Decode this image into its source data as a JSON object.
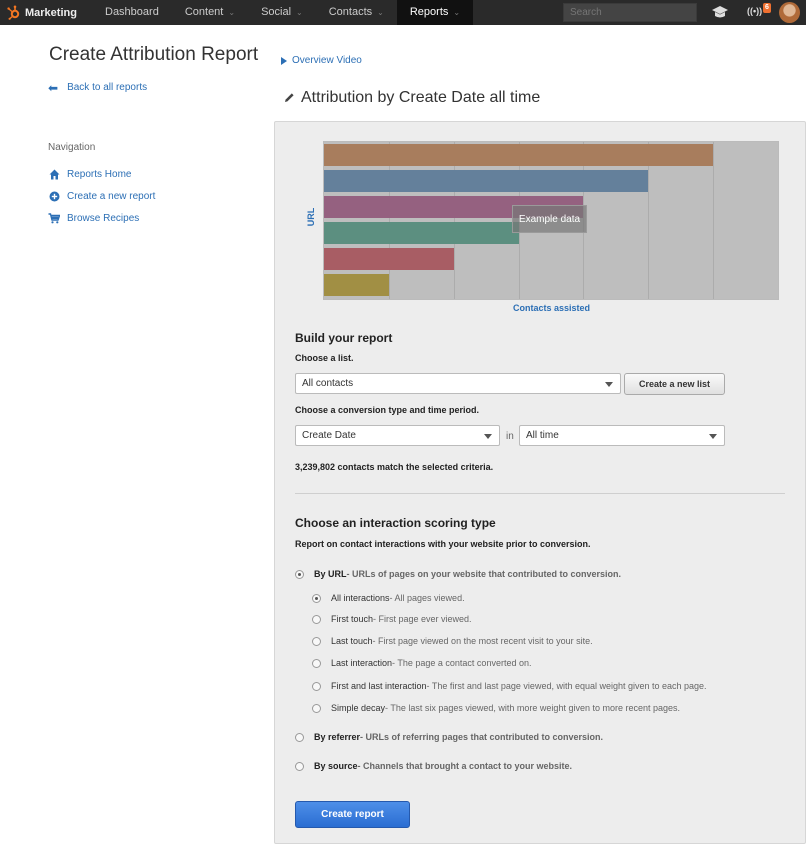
{
  "topnav": {
    "brand": "Marketing",
    "items": [
      {
        "label": "Dashboard",
        "caret": ""
      },
      {
        "label": "Content",
        "caret": "⌄"
      },
      {
        "label": "Social",
        "caret": "⌄"
      },
      {
        "label": "Contacts",
        "caret": "⌄"
      },
      {
        "label": "Reports",
        "caret": "⌄"
      }
    ],
    "active_item": "Reports",
    "search_placeholder": "Search",
    "notifications_icon": "((•))",
    "notification_count": "6",
    "icons": [
      "sprocket-logo-icon",
      "graduation-cap-icon",
      "notifications-icon",
      "avatar"
    ]
  },
  "sidebar": {
    "page_title": "Create Attribution Report",
    "back_link": "Back to all reports",
    "back_arrow": "⬅",
    "nav_heading": "Navigation",
    "nav_items": [
      {
        "label": "Reports Home",
        "icon": "home-icon"
      },
      {
        "label": "Create a new report",
        "icon": "plus-circle-icon"
      },
      {
        "label": "Browse Recipes",
        "icon": "cart-icon"
      }
    ]
  },
  "header": {
    "overview_link": "Overview Video",
    "subtitle": "Attribution by Create Date all time"
  },
  "chart_data": {
    "type": "bar",
    "orientation": "horizontal",
    "ylabel": "URL",
    "xlabel": "Contacts assisted",
    "overlay_label": "Example data",
    "grid": true,
    "values": [
      12,
      10,
      8,
      6,
      4,
      2
    ],
    "colors": [
      "#c08a60",
      "#6a8db0",
      "#a8668e",
      "#5fa08e",
      "#c0606a",
      "#b8a040"
    ]
  },
  "build": {
    "heading": "Build your report",
    "list_label": "Choose a list.",
    "list_value": "All contacts",
    "new_list_button": "Create a new list",
    "conversion_label": "Choose a conversion type and time period.",
    "conversion_value": "Create Date",
    "in_label": "in",
    "period_value": "All time",
    "match_text": "3,239,802 contacts match the selected criteria."
  },
  "scoring": {
    "heading": "Choose an interaction scoring type",
    "description": "Report on contact interactions with your website prior to conversion.",
    "by_url": {
      "label": "By URL",
      "desc": " - URLs of pages on your website that contributed to conversion.",
      "selected": true
    },
    "sub_options": [
      {
        "label": "All interactions",
        "desc": " - All pages viewed.",
        "selected": true
      },
      {
        "label": "First touch",
        "desc": " - First page ever viewed.",
        "selected": false
      },
      {
        "label": "Last touch",
        "desc": " - First page viewed on the most recent visit to your site.",
        "selected": false
      },
      {
        "label": "Last interaction",
        "desc": " - The page a contact converted on.",
        "selected": false
      },
      {
        "label": "First and last interaction",
        "desc": " - The first and last page viewed, with equal weight given to each page.",
        "selected": false
      },
      {
        "label": "Simple decay",
        "desc": " - The last six pages viewed, with more weight given to more recent pages.",
        "selected": false
      }
    ],
    "by_referrer": {
      "label": "By referrer",
      "desc": " - URLs of referring pages that contributed to conversion.",
      "selected": false
    },
    "by_source": {
      "label": "By source",
      "desc": " - Channels that brought a contact to your website.",
      "selected": false
    }
  },
  "submit_button": "Create report"
}
